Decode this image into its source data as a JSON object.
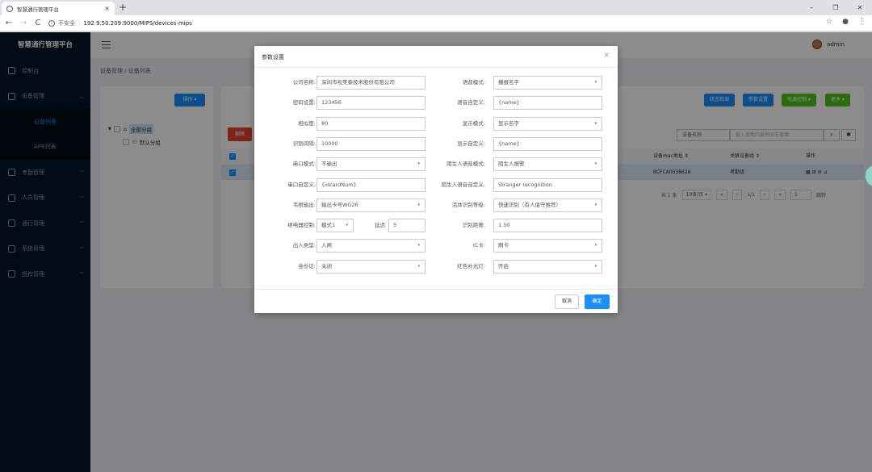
{
  "browser": {
    "tab_title": "智慧通行管理平台",
    "tab_close": "×",
    "new_tab": "+",
    "back": "←",
    "forward": "→",
    "reload": "C",
    "insecure_label": "不安全",
    "url": "192.9.50.209:9000/MIPS/devices-mips",
    "win_min": "–",
    "win_max": "❐",
    "win_close": "✕",
    "star": "☆",
    "profile": "●",
    "more": "⋮"
  },
  "sidebar": {
    "brand": "智慧通行管理平台",
    "items": [
      {
        "label": "控制台"
      },
      {
        "label": "设备管理",
        "expanded": true
      },
      {
        "label": "设备列表",
        "sub": true,
        "active": true
      },
      {
        "label": "APK列表",
        "sub": true
      },
      {
        "label": "考勤管理"
      },
      {
        "label": "人员管理"
      },
      {
        "label": "通行管理"
      },
      {
        "label": "系统管理"
      },
      {
        "label": "授权管理"
      }
    ]
  },
  "header": {
    "user": "admin"
  },
  "breadcrumb": {
    "root": "设备管理",
    "sep": "/",
    "current": "设备列表"
  },
  "left_panel": {
    "op_button": "操作 ▾",
    "tree": {
      "root": "全部分组",
      "child": "默认分组"
    }
  },
  "toolbar": {
    "status_btn": "状态检测",
    "param_btn": "参数设置",
    "power_btn": "电源控制 ▾",
    "more_btn": "更多 ▾",
    "delete_btn": "删除",
    "search_field": "设备名称",
    "search_placeholder": "输入搜索内容并回车搜索",
    "search_icon": "⌕",
    "gear_icon": "✱"
  },
  "table": {
    "headers": {
      "mac": "设备mac地址 ⇕",
      "group": "关联设备组 ⇕",
      "actions": "操作"
    },
    "row": {
      "mac": "8CFCA003862A",
      "group": "考勤组",
      "actions": "▦ ⊞ ⚙ ⊿"
    }
  },
  "pager": {
    "total": "共 1 条",
    "page_size": "10条/页 ▾",
    "first": "«",
    "prev": "‹",
    "page_of": "1/1",
    "next": "›",
    "last": "»",
    "page_input": "1",
    "jump": "跳转"
  },
  "modal": {
    "title": "参数设置",
    "close": "×",
    "left_fields": [
      {
        "label": "公司名称:",
        "value": "深圳市视美泰技术股份有限公司",
        "select": false
      },
      {
        "label": "密码设置:",
        "value": "123456",
        "select": false
      },
      {
        "label": "相似度:",
        "value": "80",
        "select": false
      },
      {
        "label": "识别间隔:",
        "value": "10000",
        "select": false
      },
      {
        "label": "串口模式:",
        "value": "不输出",
        "select": true
      },
      {
        "label": "串口自定义:",
        "value": "{idcardNum}",
        "select": false
      },
      {
        "label": "韦根输出:",
        "value": "输出卡号WG26",
        "select": true
      },
      {
        "label": "出入类型:",
        "value": "入闸",
        "select": true
      },
      {
        "label": "身份证:",
        "value": "关闭",
        "select": true
      }
    ],
    "relay": {
      "label": "继电器控制:",
      "mode": "模式1",
      "delay_label": "延迟",
      "delay_value": "5"
    },
    "right_fields": [
      {
        "label": "语音模式:",
        "value": "播报名字",
        "select": true
      },
      {
        "label": "语音自定义:",
        "value": "{name}",
        "select": false
      },
      {
        "label": "显示模式:",
        "value": "显示名字",
        "select": true
      },
      {
        "label": "显示自定义:",
        "value": "{name}",
        "select": false
      },
      {
        "label": "陌生人语音模式:",
        "value": "陌生人报警",
        "select": true
      },
      {
        "label": "陌生人语音自定义:",
        "value": "Stranger recognition",
        "select": false
      },
      {
        "label": "活体识别等级:",
        "value": "快速识别（有人值守推荐）",
        "select": true
      },
      {
        "label": "识别距离:",
        "value": "1.50",
        "select": false
      },
      {
        "label": "IC卡:",
        "value": "刷卡",
        "select": true
      },
      {
        "label": "红色补光灯:",
        "value": "开启",
        "select": true
      }
    ],
    "cancel": "取消",
    "ok": "确定",
    "caret": "▾"
  },
  "colors": {
    "primary": "#1890ff",
    "sidebar": "#001529",
    "danger": "#e0442f",
    "success": "#52c41a"
  }
}
